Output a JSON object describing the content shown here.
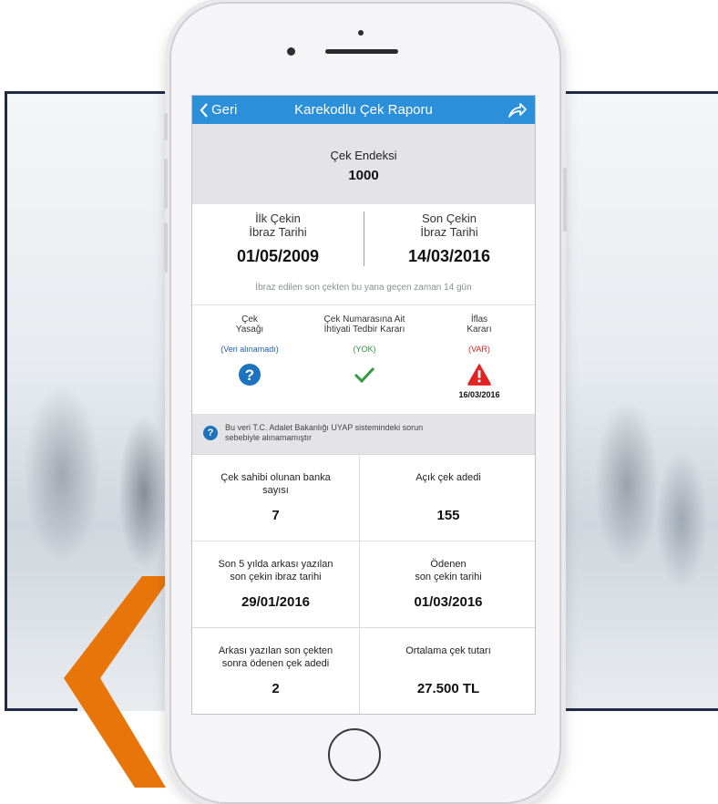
{
  "nav": {
    "back_label": "Geri",
    "title": "Karekodlu Çek Raporu"
  },
  "index": {
    "label": "Çek Endeksi",
    "value": "1000"
  },
  "dates": {
    "first_label_line1": "İlk Çekin",
    "first_label_line2": "İbraz Tarihi",
    "first_value": "01/05/2009",
    "last_label_line1": "Son Çekin",
    "last_label_line2": "İbraz Tarihi",
    "last_value": "14/03/2016",
    "note": "İbraz edilen son çekten bu yana geçen zaman 14 gün"
  },
  "status": [
    {
      "title_line1": "Çek",
      "title_line2": "Yasağı",
      "value": "(Veri alınamadı)",
      "value_color": "#1e5fb8",
      "icon": "question-icon",
      "date": ""
    },
    {
      "title_line1": "Çek Numarasına Ait",
      "title_line2": "İhtiyati Tedbir Kararı",
      "value": "(YOK)",
      "value_color": "#2e9a3a",
      "icon": "check-icon",
      "date": ""
    },
    {
      "title_line1": "İflas",
      "title_line2": "Kararı",
      "value": "(VAR)",
      "value_color": "#e02424",
      "icon": "warning-icon",
      "date": "16/03/2016"
    }
  ],
  "info": {
    "text_line1": "Bu veri T.C. Adalet Bakanlığı UYAP sistemindeki sorun",
    "text_line2": "sebebiyle alınamamıştır"
  },
  "stats": [
    {
      "label_line1": "Çek sahibi olunan banka",
      "label_line2": "sayısı",
      "value": "7"
    },
    {
      "label_line1": "Açık çek adedi",
      "label_line2": "",
      "value": "155"
    },
    {
      "label_line1": "Son 5 yılda arkası yazılan",
      "label_line2": "son çekin ibraz tarihi",
      "value": "29/01/2016"
    },
    {
      "label_line1": "Ödenen",
      "label_line2": "son çekin tarihi",
      "value": "01/03/2016"
    },
    {
      "label_line1": "Arkası yazılan son çekten",
      "label_line2": "sonra ödenen çek adedi",
      "value": "2"
    },
    {
      "label_line1": "Ortalama çek tutarı",
      "label_line2": "",
      "value": "27.500 TL"
    }
  ],
  "colors": {
    "nav_blue": "#2c8fd9",
    "frame_navy": "#1e2c45",
    "chevron_orange": "#e8750a",
    "question_blue": "#1e73be",
    "check_green": "#2e9a3a",
    "warning_red": "#e02424"
  }
}
